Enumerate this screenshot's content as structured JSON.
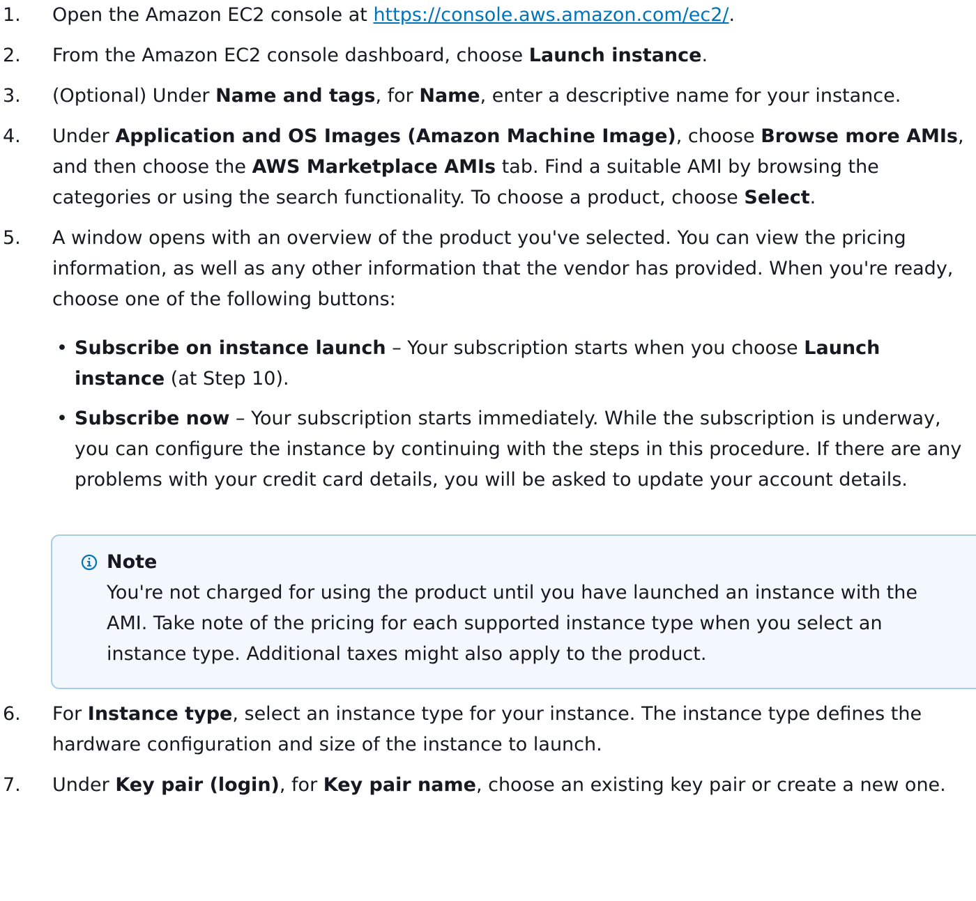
{
  "steps": {
    "s1": {
      "num": "1.",
      "text_before": "Open the Amazon EC2 console at ",
      "link": "https://console.aws.amazon.com/ec2/",
      "text_after": "."
    },
    "s2": {
      "num": "2.",
      "t1": "From the Amazon EC2 console dashboard, choose ",
      "b1": "Launch instance",
      "t2": "."
    },
    "s3": {
      "num": "3.",
      "t1": "(Optional) Under ",
      "b1": "Name and tags",
      "t2": ", for ",
      "b2": "Name",
      "t3": ", enter a descriptive name for your instance."
    },
    "s4": {
      "num": "4.",
      "t1": "Under ",
      "b1": "Application and OS Images (Amazon Machine Image)",
      "t2": ", choose ",
      "b2": "Browse more AMIs",
      "t3": ", and then choose the ",
      "b3": "AWS Marketplace AMIs",
      "t4": " tab. Find a suitable AMI by browsing the categories or using the search functionality. To choose a product, choose ",
      "b4": "Select",
      "t5": "."
    },
    "s5": {
      "num": "5.",
      "text": "A window opens with an overview of the product you've selected. You can view the pricing information, as well as any other information that the vendor has provided. When you're ready, choose one of the following buttons:",
      "options": {
        "o1": {
          "bullet": "•",
          "b1": "Subscribe on instance launch",
          "t1": " – Your subscription starts when you choose ",
          "b2": "Launch instance",
          "t2": " (at Step 10)."
        },
        "o2": {
          "bullet": "•",
          "b1": "Subscribe now",
          "t1": " – Your subscription starts immediately. While the subscription is underway, you can configure the instance by continuing with the steps in this procedure. If there are any problems with your credit card details, you will be asked to update your account details."
        }
      },
      "note": {
        "icon": "info-icon",
        "title": "Note",
        "text": "You're not charged for using the product until you have launched an instance with the AMI. Take note of the pricing for each supported instance type when you select an instance type. Additional taxes might also apply to the product."
      }
    },
    "s6": {
      "num": "6.",
      "t1": "For ",
      "b1": "Instance type",
      "t2": ", select an instance type for your instance. The instance type defines the hardware configuration and size of the instance to launch."
    },
    "s7": {
      "num": "7.",
      "t1": "Under ",
      "b1": "Key pair (login)",
      "t2": ", for ",
      "b2": "Key pair name",
      "t3": ", choose an existing key pair or create a new one."
    }
  },
  "colors": {
    "text": "#16191f",
    "link": "#0073bb",
    "note_border": "#a8cce6",
    "note_background": "#f2f8fd",
    "info_icon": "#0073bb"
  }
}
